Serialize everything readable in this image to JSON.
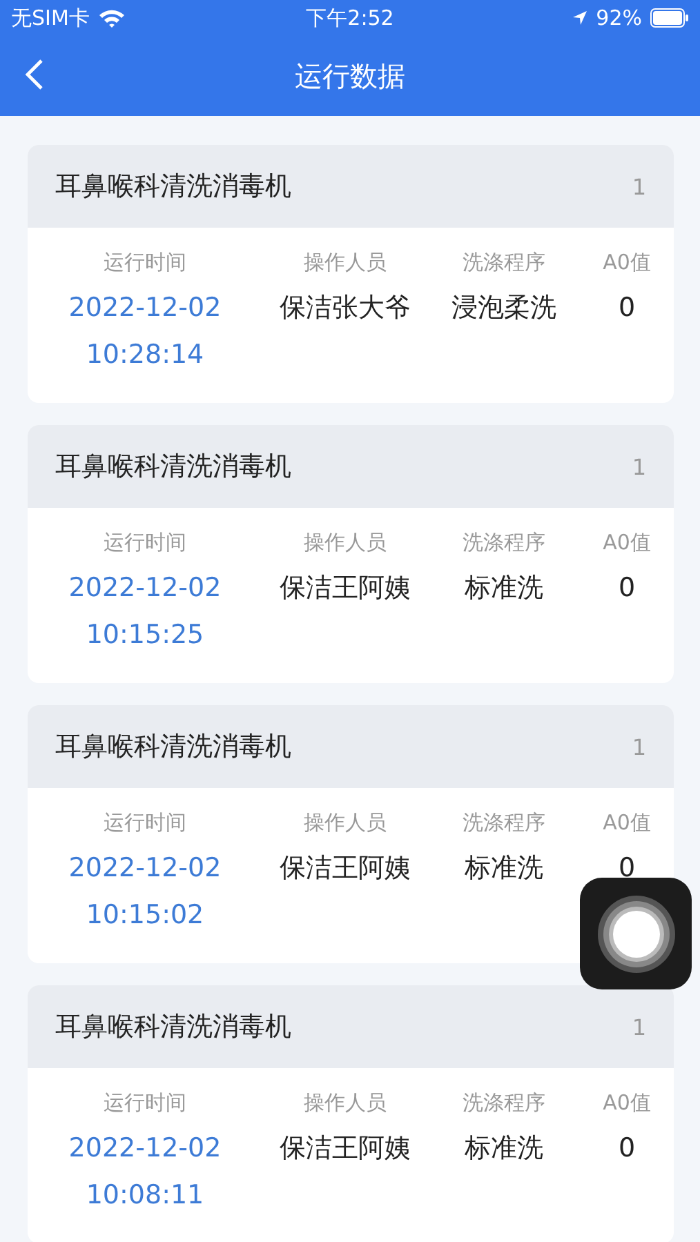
{
  "status_bar": {
    "carrier": "无SIM卡",
    "time": "下午2:52",
    "battery": "92%"
  },
  "nav": {
    "title": "运行数据"
  },
  "records": [
    {
      "device": "耳鼻喉科清洗消毒机",
      "count": "1",
      "columns": [
        "运行时间",
        "操作人员",
        "洗涤程序",
        "A0值"
      ],
      "date": "2022-12-02",
      "time": "10:28:14",
      "operator": "保洁张大爷",
      "program": "浸泡柔洗",
      "a0": "0"
    },
    {
      "device": "耳鼻喉科清洗消毒机",
      "count": "1",
      "columns": [
        "运行时间",
        "操作人员",
        "洗涤程序",
        "A0值"
      ],
      "date": "2022-12-02",
      "time": "10:15:25",
      "operator": "保洁王阿姨",
      "program": "标准洗",
      "a0": "0"
    },
    {
      "device": "耳鼻喉科清洗消毒机",
      "count": "1",
      "columns": [
        "运行时间",
        "操作人员",
        "洗涤程序",
        "A0值"
      ],
      "date": "2022-12-02",
      "time": "10:15:02",
      "operator": "保洁王阿姨",
      "program": "标准洗",
      "a0": "0"
    },
    {
      "device": "耳鼻喉科清洗消毒机",
      "count": "1",
      "columns": [
        "运行时间",
        "操作人员",
        "洗涤程序",
        "A0值"
      ],
      "date": "2022-12-02",
      "time": "10:08:11",
      "operator": "保洁王阿姨",
      "program": "标准洗",
      "a0": "0"
    }
  ]
}
